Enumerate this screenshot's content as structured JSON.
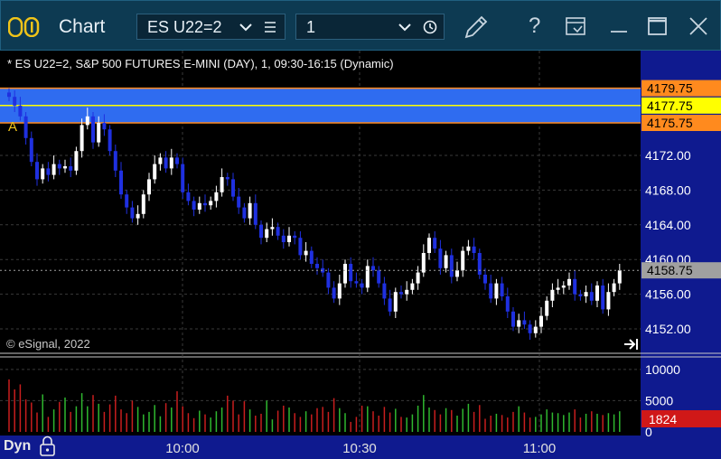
{
  "window": {
    "title": "Chart",
    "symbol": "ES U22=2",
    "interval": "1",
    "help_label": "?"
  },
  "chart": {
    "title": "* ES U22=2, S&P 500 FUTURES E-MINI (DAY), 1, 09:30-16:15 (Dynamic)",
    "copyright": "© eSignal, 2022",
    "marker": "A",
    "mode": "Dyn",
    "price_ticks": [
      "4172.00",
      "4168.00",
      "4164.00",
      "4160.00",
      "4156.00",
      "4152.00"
    ],
    "price_labels": {
      "upper": "4179.75",
      "mid": "4177.75",
      "lower": "4175.75",
      "last": "4158.75"
    },
    "volume_ticks": [
      "10000",
      "5000",
      "0"
    ],
    "volume_last": "1824",
    "time_ticks": [
      "10:00",
      "10:30",
      "11:00"
    ],
    "colors": {
      "band": "#2f6cf0",
      "up": "#ffffff",
      "down": "#1f30e0",
      "vol_up": "#2fb82f",
      "vol_down": "#c81e1e",
      "label_orange": "#ff8a1e",
      "label_yellow": "#ffff00"
    }
  },
  "chart_data": {
    "type": "candlestick",
    "closes": [
      4178.75,
      4177.75,
      4176.5,
      4174,
      4171.25,
      4169.25,
      4170.5,
      4169.75,
      4171,
      4170.5,
      4170.75,
      4170.25,
      4172.5,
      4175.5,
      4176.5,
      4173.5,
      4175.75,
      4175,
      4172.5,
      4170.25,
      4167.5,
      4166,
      4164.75,
      4165.25,
      4167.5,
      4169.25,
      4171,
      4171.75,
      4170.5,
      4171.75,
      4171,
      4167.75,
      4166.75,
      4165.75,
      4166.5,
      4166.25,
      4166.75,
      4167.75,
      4169.5,
      4169.25,
      4167.25,
      4166,
      4164.75,
      4166.5,
      4164,
      4162.5,
      4163.5,
      4163.75,
      4162.75,
      4162,
      4162.75,
      4162.5,
      4160.5,
      4161,
      4159.5,
      4159,
      4158.5,
      4156.75,
      4155.5,
      4157.25,
      4159.5,
      4157.5,
      4157.25,
      4156.75,
      4159.25,
      4158.75,
      4157.25,
      4155.5,
      4154,
      4156.25,
      4156,
      4156.5,
      4157.25,
      4158.5,
      4160.75,
      4162.5,
      4161.25,
      4159,
      4160.5,
      4158,
      4158.75,
      4161,
      4161.5,
      4160.75,
      4158.25,
      4157.25,
      4155.5,
      4157.25,
      4155.75,
      4154,
      4152.25,
      4153,
      4152.5,
      4151.5,
      4152.25,
      4153.5,
      4155.25,
      4156.5,
      4156.75,
      4157,
      4157.75,
      4156,
      4155.75,
      4156.25,
      4155.25,
      4157,
      4154.25,
      4156.25,
      4157.25,
      4158.75
    ],
    "volumes": [
      8400,
      6800,
      7600,
      5200,
      4700,
      3100,
      6000,
      2400,
      3600,
      4800,
      5500,
      3200,
      4100,
      6200,
      4100,
      5900,
      4500,
      3200,
      4400,
      5800,
      3600,
      3000,
      5000,
      4000,
      2800,
      3200,
      4300,
      2500,
      4600,
      3900,
      6500,
      4100,
      3000,
      2200,
      3400,
      2800,
      2300,
      3300,
      3900,
      5800,
      5000,
      2800,
      4900,
      3600,
      2600,
      2900,
      5000,
      2000,
      3400,
      4200,
      3900,
      3000,
      2400,
      3300,
      2800,
      3800,
      4000,
      3200,
      5400,
      3800,
      3000,
      1600,
      2400,
      4200,
      4100,
      3300,
      2600,
      4000,
      3100,
      3700,
      2400,
      2300,
      2800,
      4200,
      5900,
      3900,
      3500,
      2800,
      3800,
      3500,
      2600,
      3700,
      4500,
      3200,
      4300,
      2100,
      2600,
      2900,
      2700,
      2300,
      3200,
      4100,
      3100,
      2300,
      2400,
      2800,
      3600,
      3100,
      3000,
      2700,
      3100,
      3600,
      2300,
      2900,
      3300,
      2900,
      2700,
      3000,
      2800,
      3300
    ],
    "band": {
      "high": 4179.75,
      "mid": 4177.75,
      "low": 4175.75
    },
    "last": 4158.75,
    "y_range": [
      4150,
      4182
    ],
    "volume_range": [
      0,
      12000
    ]
  }
}
